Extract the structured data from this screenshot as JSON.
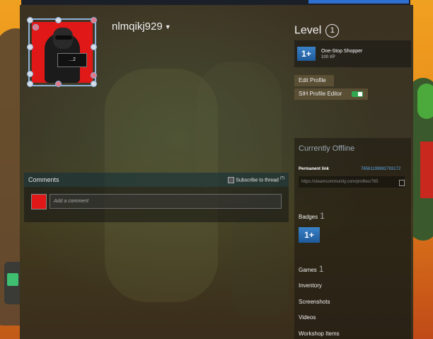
{
  "profile": {
    "username": "nlmqikj929",
    "avatar_tag": "...2"
  },
  "level": {
    "label": "Level",
    "value": "1"
  },
  "featured_badge": {
    "icon_text": "1+",
    "name": "One-Stop Shopper",
    "xp": "100 XP"
  },
  "buttons": {
    "edit_profile": "Edit Profile",
    "sih_editor": "SIH Profile Editor"
  },
  "sidebar": {
    "status": "Currently Offline",
    "permanent_link_label": "Permanent link",
    "permanent_link_id": "76561199882793172",
    "permanent_link_url": "https://steamcommunity.com/profiles/765",
    "badges_label": "Badges",
    "badges_count": "1",
    "badge_icon_text": "1+",
    "games_label": "Games",
    "games_count": "1",
    "links": [
      "Inventory",
      "Screenshots",
      "Videos",
      "Workshop Items"
    ]
  },
  "comments": {
    "title": "Comments",
    "subscribe_label": "Subscribe to thread",
    "subscribe_count": "(?)",
    "placeholder": "Add a comment"
  },
  "colors": {
    "link_blue": "#5aa9e6",
    "toggle_on": "#2fa84f",
    "avatar_red": "#e01818"
  }
}
